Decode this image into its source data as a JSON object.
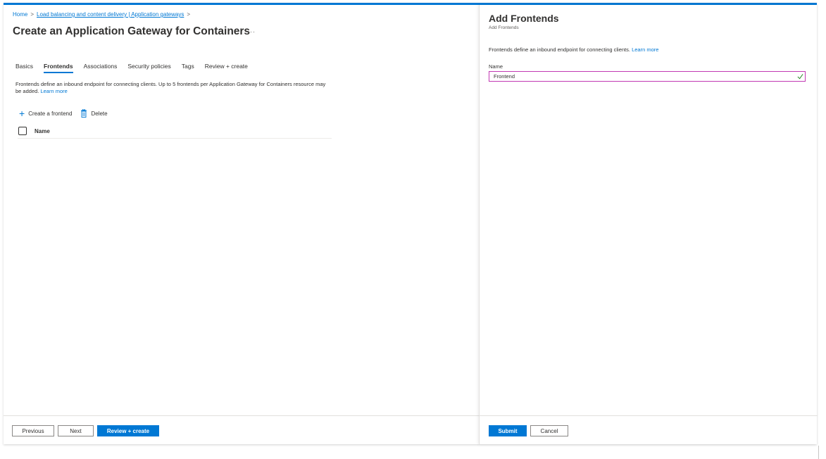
{
  "breadcrumb": {
    "home": "Home",
    "trail": "Load balancing and content delivery | Application gateways"
  },
  "page": {
    "title": "Create an Application Gateway for Containers",
    "more": "···"
  },
  "tabs": [
    {
      "label": "Basics",
      "active": false
    },
    {
      "label": "Frontends",
      "active": true
    },
    {
      "label": "Associations",
      "active": false
    },
    {
      "label": "Security policies",
      "active": false
    },
    {
      "label": "Tags",
      "active": false
    },
    {
      "label": "Review + create",
      "active": false
    }
  ],
  "frontends": {
    "description": "Frontends define an inbound endpoint for connecting clients. Up to 5 frontends per Application Gateway for Containers resource may be added.",
    "learn_more": "Learn more",
    "create_label": "Create a frontend",
    "delete_label": "Delete",
    "column_name": "Name"
  },
  "footer": {
    "previous": "Previous",
    "next": "Next",
    "review_create": "Review + create"
  },
  "panel": {
    "title": "Add Frontends",
    "subtitle": "Add Frontends",
    "description": "Frontends define an inbound endpoint for connecting clients.",
    "learn_more": "Learn more",
    "name_label": "Name",
    "name_value": "Frontend",
    "submit": "Submit",
    "cancel": "Cancel"
  },
  "colors": {
    "accent": "#0078d4",
    "input_border": "#c239b3",
    "valid_check": "#107c10"
  },
  "icons": {
    "plus": "plus-icon",
    "trash": "trash-icon",
    "check": "checkmark-icon",
    "chevron": "chevron-right-icon"
  }
}
